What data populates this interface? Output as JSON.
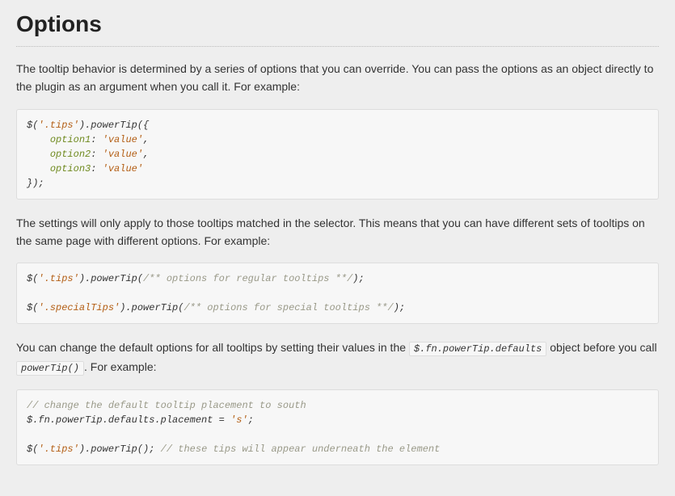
{
  "heading": "Options",
  "para1": "The tooltip behavior is determined by a series of options that you can override. You can pass the options as an object directly to the plugin as an argument when you call it. For example:",
  "code1": {
    "l1a": "$(",
    "l1b": "'.tips'",
    "l1c": ").powerTip({",
    "l2a": "option1",
    "l2b": ": ",
    "l2c": "'value'",
    "l2d": ",",
    "l3a": "option2",
    "l3b": ": ",
    "l3c": "'value'",
    "l3d": ",",
    "l4a": "option3",
    "l4b": ": ",
    "l4c": "'value'",
    "l5": "});"
  },
  "para2": "The settings will only apply to those tooltips matched in the selector. This means that you can have different sets of tooltips on the same page with different options. For example:",
  "code2": {
    "l1a": "$(",
    "l1b": "'.tips'",
    "l1c": ").powerTip(",
    "l1d": "/** options for regular tooltips **/",
    "l1e": ");",
    "l2a": "$(",
    "l2b": "'.specialTips'",
    "l2c": ").powerTip(",
    "l2d": "/** options for special tooltips **/",
    "l2e": ");"
  },
  "para3a": "You can change the default options for all tooltips by setting their values in the ",
  "inline1": "$.fn.powerTip.defaults",
  "para3b": " object before you call ",
  "inline2": "powerTip()",
  "para3c": ". For example:",
  "code3": {
    "l1": "// change the default tooltip placement to south",
    "l2a": "$.fn.powerTip.defaults.placement = ",
    "l2b": "'s'",
    "l2c": ";",
    "l3a": "$(",
    "l3b": "'.tips'",
    "l3c": ").powerTip(); ",
    "l3d": "// these tips will appear underneath the element"
  }
}
